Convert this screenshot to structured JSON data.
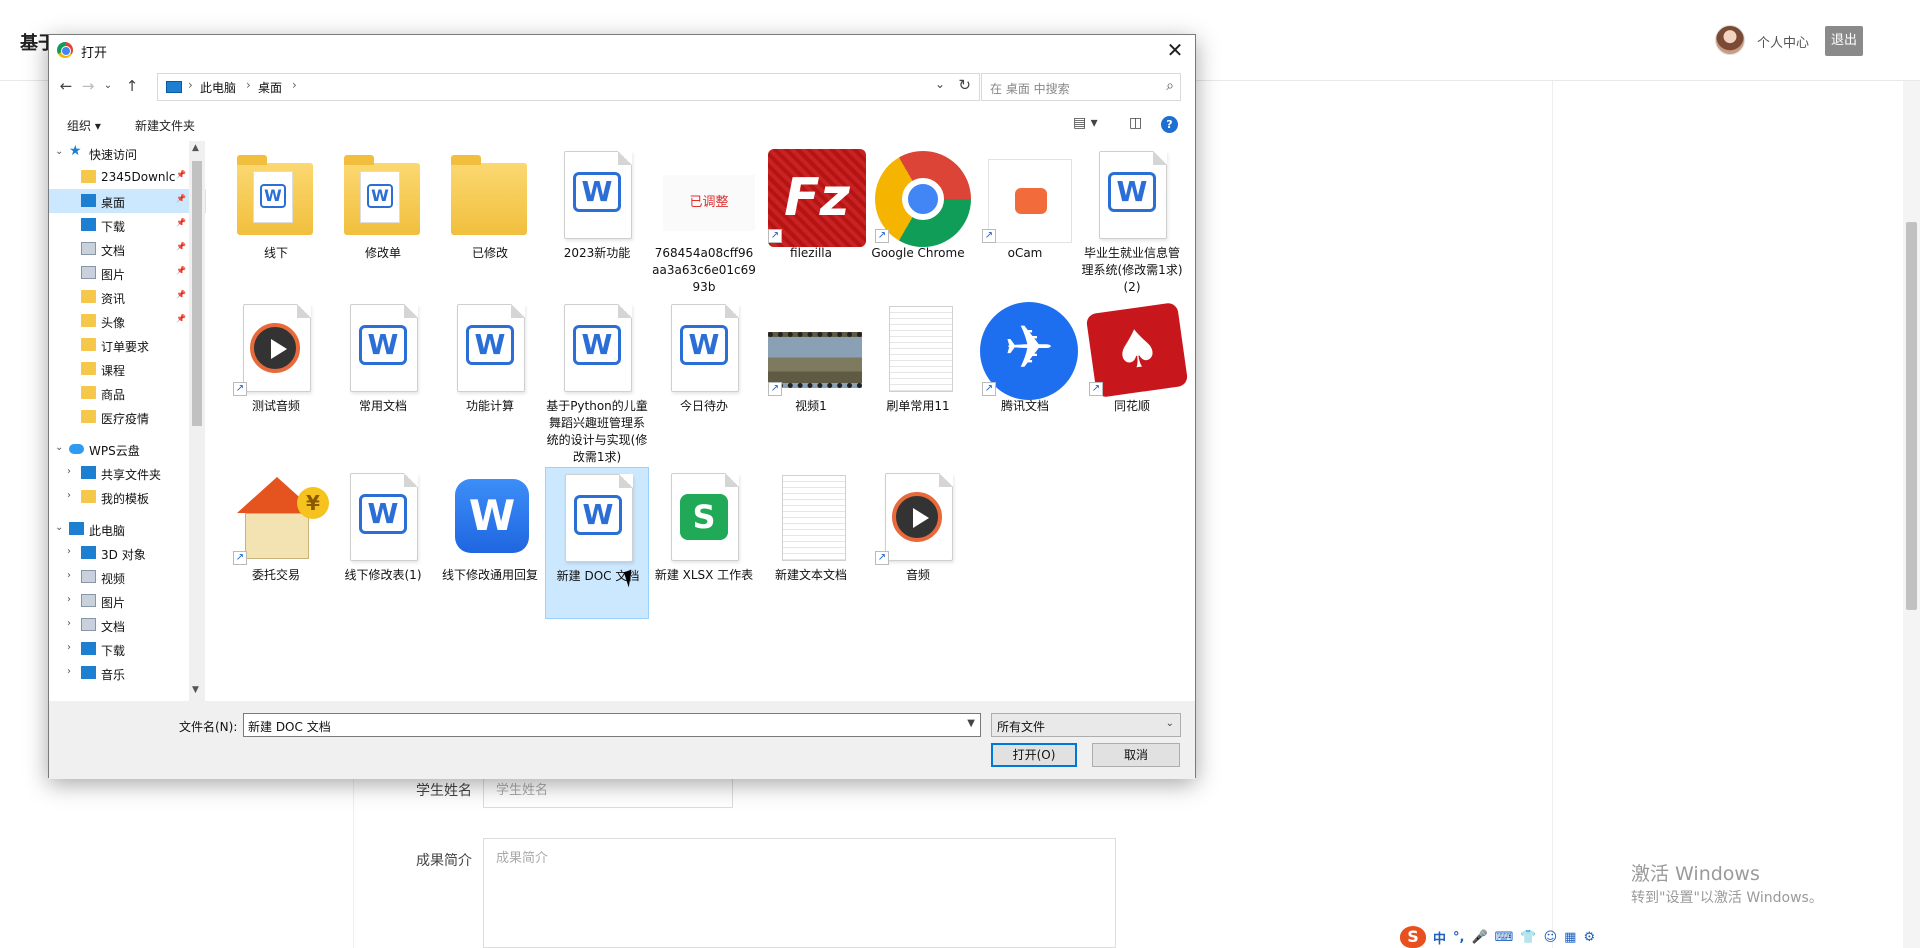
{
  "page": {
    "title": "基于...",
    "user_center": "个人中心",
    "logout": "退出",
    "form": {
      "student_name_label": "学生姓名",
      "student_name_placeholder": "学生姓名",
      "summary_label": "成果简介",
      "summary_placeholder": "成果简介"
    },
    "watermark_line1": "激活 Windows",
    "watermark_line2": "转到\"设置\"以激活 Windows。"
  },
  "ime": {
    "logo": "S",
    "items": [
      "中",
      "°,",
      "🎤",
      "⌨",
      "👕",
      "☺",
      "▦",
      "⚙"
    ]
  },
  "dialog": {
    "title": "打开",
    "close": "✕",
    "breadcrumb": [
      "此电脑",
      "桌面"
    ],
    "search_placeholder": "在 桌面 中搜索",
    "toolbar": {
      "organize": "组织 ▾",
      "new_folder": "新建文件夹"
    },
    "nav": [
      {
        "label": "快速访问",
        "icon": "star"
      },
      {
        "label": "2345Downlc",
        "icon": "folder",
        "pinned": true
      },
      {
        "label": "桌面",
        "icon": "desktop",
        "pinned": true,
        "selected": true
      },
      {
        "label": "下载",
        "icon": "download",
        "pinned": true
      },
      {
        "label": "文档",
        "icon": "documents",
        "pinned": true
      },
      {
        "label": "图片",
        "icon": "pictures",
        "pinned": true
      },
      {
        "label": "资讯",
        "icon": "folder",
        "pinned": true
      },
      {
        "label": "头像",
        "icon": "folder",
        "pinned": true
      },
      {
        "label": "订单要求",
        "icon": "folder"
      },
      {
        "label": "课程",
        "icon": "folder"
      },
      {
        "label": "商品",
        "icon": "folder"
      },
      {
        "label": "医疗疫情",
        "icon": "folder"
      },
      {
        "label": "WPS云盘",
        "icon": "cloud"
      },
      {
        "label": "共享文件夹",
        "icon": "share"
      },
      {
        "label": "我的模板",
        "icon": "folder"
      },
      {
        "label": "此电脑",
        "icon": "pc"
      },
      {
        "label": "3D 对象",
        "icon": "3d"
      },
      {
        "label": "视频",
        "icon": "videos"
      },
      {
        "label": "图片",
        "icon": "pictures"
      },
      {
        "label": "文档",
        "icon": "documents"
      },
      {
        "label": "下载",
        "icon": "download"
      },
      {
        "label": "音乐",
        "icon": "music"
      }
    ],
    "files": [
      {
        "name": "线下",
        "type": "folder-doc"
      },
      {
        "name": "修改单",
        "type": "folder-doc"
      },
      {
        "name": "已修改",
        "type": "folder"
      },
      {
        "name": "2023新功能",
        "type": "wps-doc"
      },
      {
        "name": "768454a08cff96aa3a63c6e01c6993b",
        "type": "image",
        "thumb_text": "已调整"
      },
      {
        "name": "filezilla",
        "type": "filezilla",
        "shortcut": true
      },
      {
        "name": "Google Chrome",
        "type": "chrome",
        "shortcut": true
      },
      {
        "name": "oCam",
        "type": "ocam",
        "shortcut": true
      },
      {
        "name": "毕业生就业信息管理系统(修改需1求) (2)",
        "type": "wps-doc"
      },
      {
        "name": "测试音频",
        "type": "audio",
        "shortcut": true
      },
      {
        "name": "常用文档",
        "type": "wps-doc"
      },
      {
        "name": "功能计算",
        "type": "wps-doc"
      },
      {
        "name": "基于Python的儿童舞蹈兴趣班管理系统的设计与实现(修改需1求)",
        "type": "wps-doc"
      },
      {
        "name": "今日待办",
        "type": "wps-doc"
      },
      {
        "name": "视频1",
        "type": "video",
        "shortcut": true
      },
      {
        "name": "刷单常用11",
        "type": "text"
      },
      {
        "name": "腾讯文档",
        "type": "tencent",
        "shortcut": true
      },
      {
        "name": "同花顺",
        "type": "cards",
        "shortcut": true
      },
      {
        "name": "委托交易",
        "type": "house",
        "shortcut": true
      },
      {
        "name": "线下修改表(1)",
        "type": "wps-doc"
      },
      {
        "name": "线下修改通用回复",
        "type": "wps-blue"
      },
      {
        "name": "新建 DOC 文档",
        "type": "wps-doc",
        "selected": true
      },
      {
        "name": "新建 XLSX 工作表",
        "type": "xlsx"
      },
      {
        "name": "新建文本文档",
        "type": "text"
      },
      {
        "name": "音频",
        "type": "audio",
        "shortcut": true
      }
    ],
    "filename_label": "文件名(N):",
    "filename_value": "新建 DOC 文档",
    "filetype_value": "所有文件",
    "open_button": "打开(O)",
    "cancel_button": "取消"
  }
}
